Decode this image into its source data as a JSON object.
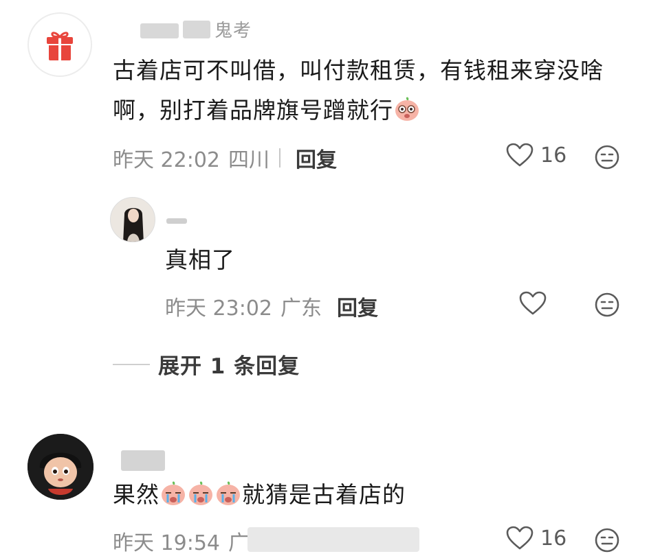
{
  "comments": [
    {
      "text": "古着店可不叫借，叫付款租赁，有钱租来穿没啥啊，别打着品牌旗号蹭就行",
      "time": "昨天 22:02",
      "location": "四川",
      "reply_label": "回复",
      "likes": "16"
    },
    {
      "text": "真相了",
      "time": "昨天 23:02",
      "location": "广东",
      "reply_label": "回复",
      "likes": ""
    },
    {
      "text": "就猜是古着店的",
      "text_prefix": "果然",
      "time": "昨天 19:54",
      "location": "广",
      "likes": "16"
    }
  ],
  "expand_replies_label": "展开 1 条回复",
  "icons": {
    "avatar1": "gift-icon",
    "emoji": "peach-emoji-icon",
    "like": "heart-outline-icon",
    "more": "smiley-neutral-icon"
  },
  "colors": {
    "text": "#1a1a1a",
    "meta": "#8c8c8c",
    "gift_red": "#e8453c"
  }
}
